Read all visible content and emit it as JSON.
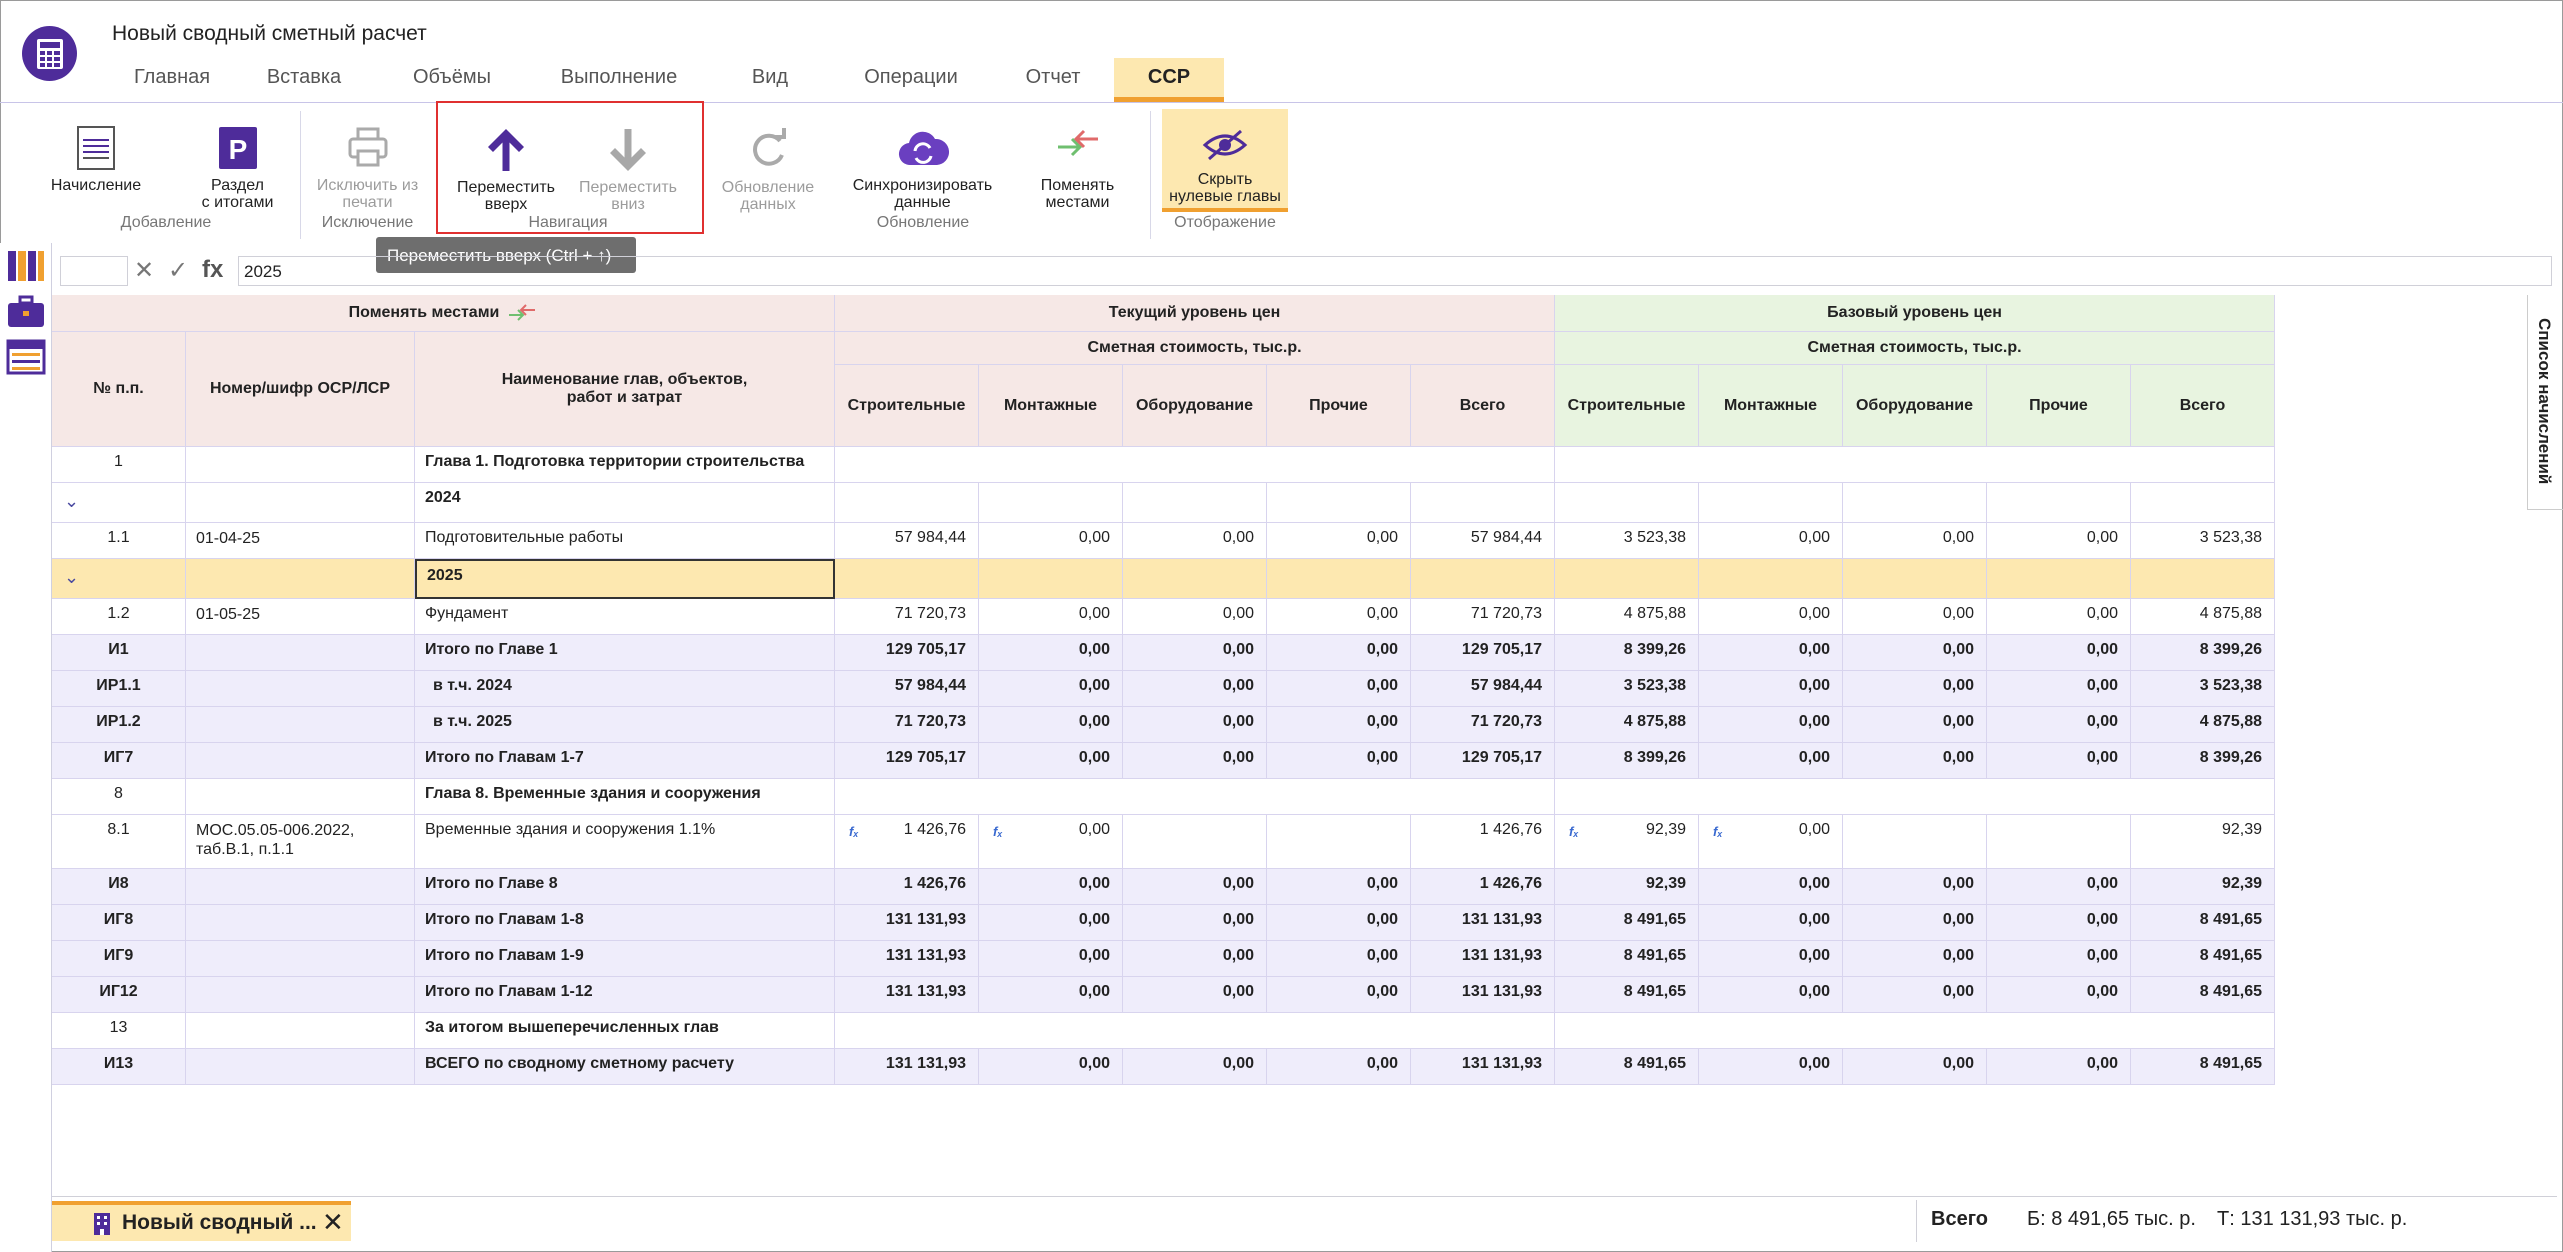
{
  "window": {
    "title": "Новый сводный сметный расчет"
  },
  "tabs": [
    {
      "label": "Главная"
    },
    {
      "label": "Вставка"
    },
    {
      "label": "Объёмы"
    },
    {
      "label": "Выполнение"
    },
    {
      "label": "Вид"
    },
    {
      "label": "Операции"
    },
    {
      "label": "Отчет"
    },
    {
      "label": "ССР",
      "active": true
    }
  ],
  "ribbon": {
    "buttons": {
      "accrual": "Начисление",
      "section_line1": "Раздел",
      "section_line2": "с итогами",
      "exclude_line1": "Исключить из",
      "exclude_line2": "печати",
      "up_line1": "Переместить",
      "up_line2": "вверх",
      "down_line1": "Переместить",
      "down_line2": "вниз",
      "refresh_line1": "Обновление",
      "refresh_line2": "данных",
      "sync_line1": "Синхронизировать",
      "sync_line2": "данные",
      "swap_line1": "Поменять",
      "swap_line2": "местами",
      "hide_line1": "Скрыть",
      "hide_line2": "нулевые главы"
    },
    "groups": {
      "add": "Добавление",
      "exclude": "Исключение",
      "nav": "Навигация",
      "update": "Обновление",
      "display": "Отображение"
    },
    "tooltip": "Переместить вверх (Ctrl + ↑)"
  },
  "formula_bar": {
    "value": "2025",
    "fx": "fx",
    "cancel": "✕",
    "accept": "✓"
  },
  "grid": {
    "header": {
      "swap": "Поменять местами",
      "current": "Текущий уровень цен",
      "base": "Базовый уровень цен",
      "cost_current": "Сметная стоимость, тыс.р.",
      "cost_base": "Сметная стоимость, тыс.р.",
      "col_no": "№ п.п.",
      "col_code": "Номер/шифр ОСР/ЛСР",
      "col_name_line1": "Наименование глав, объектов,",
      "col_name_line2": "работ и затрат",
      "sub": [
        "Строительные",
        "Монтажные",
        "Оборудование",
        "Прочие",
        "Всего"
      ]
    },
    "rows": [
      {
        "no": "1",
        "code": "",
        "name": "Глава 1. Подготовка территории строительства",
        "bold_name": true,
        "cur": [],
        "base": []
      },
      {
        "no": "",
        "code": "",
        "name": "2024",
        "bold_name": true,
        "chevron": true,
        "cur": [],
        "base": [],
        "grid_vals": true
      },
      {
        "no": "1.1",
        "code": "01-04-25",
        "name": "Подготовительные работы",
        "cur": [
          "57 984,44",
          "0,00",
          "0,00",
          "0,00",
          "57 984,44"
        ],
        "base": [
          "3 523,38",
          "0,00",
          "0,00",
          "0,00",
          "3 523,38"
        ]
      },
      {
        "no": "",
        "code": "",
        "name": "2025",
        "bold_name": true,
        "chevron": true,
        "selected": true,
        "cur": [],
        "base": [],
        "grid_vals": true
      },
      {
        "no": "1.2",
        "code": "01-05-25",
        "name": "Фундамент",
        "cur": [
          "71 720,73",
          "0,00",
          "0,00",
          "0,00",
          "71 720,73"
        ],
        "base": [
          "4 875,88",
          "0,00",
          "0,00",
          "0,00",
          "4 875,88"
        ]
      },
      {
        "no": "И1",
        "code": "",
        "name": "Итого по Главе 1",
        "total": true,
        "cur": [
          "129 705,17",
          "0,00",
          "0,00",
          "0,00",
          "129 705,17"
        ],
        "base": [
          "8 399,26",
          "0,00",
          "0,00",
          "0,00",
          "8 399,26"
        ]
      },
      {
        "no": "ИР1.1",
        "code": "",
        "name": "в т.ч. 2024",
        "total": true,
        "indent": true,
        "cur": [
          "57 984,44",
          "0,00",
          "0,00",
          "0,00",
          "57 984,44"
        ],
        "base": [
          "3 523,38",
          "0,00",
          "0,00",
          "0,00",
          "3 523,38"
        ]
      },
      {
        "no": "ИР1.2",
        "code": "",
        "name": "в т.ч. 2025",
        "total": true,
        "indent": true,
        "cur": [
          "71 720,73",
          "0,00",
          "0,00",
          "0,00",
          "71 720,73"
        ],
        "base": [
          "4 875,88",
          "0,00",
          "0,00",
          "0,00",
          "4 875,88"
        ]
      },
      {
        "no": "ИГ7",
        "code": "",
        "name": "Итого по Главам 1-7",
        "total": true,
        "cur": [
          "129 705,17",
          "0,00",
          "0,00",
          "0,00",
          "129 705,17"
        ],
        "base": [
          "8 399,26",
          "0,00",
          "0,00",
          "0,00",
          "8 399,26"
        ]
      },
      {
        "no": "8",
        "code": "",
        "name": "Глава 8. Временные здания и сооружения",
        "bold_name": true,
        "cur": [],
        "base": []
      },
      {
        "no": "8.1",
        "code": "МОС.05.05-006.2022,",
        "code2": "таб.В.1, п.1.1",
        "name": "Временные здания и сооружения 1.1%",
        "tall": true,
        "fx": true,
        "cur": [
          "1 426,76",
          "0,00",
          "",
          "",
          "1 426,76"
        ],
        "base": [
          "92,39",
          "0,00",
          "",
          "",
          "92,39"
        ]
      },
      {
        "no": "И8",
        "code": "",
        "name": "Итого по Главе 8",
        "total": true,
        "cur": [
          "1 426,76",
          "0,00",
          "0,00",
          "0,00",
          "1 426,76"
        ],
        "base": [
          "92,39",
          "0,00",
          "0,00",
          "0,00",
          "92,39"
        ]
      },
      {
        "no": "ИГ8",
        "code": "",
        "name": "Итого по Главам 1-8",
        "total": true,
        "cur": [
          "131 131,93",
          "0,00",
          "0,00",
          "0,00",
          "131 131,93"
        ],
        "base": [
          "8 491,65",
          "0,00",
          "0,00",
          "0,00",
          "8 491,65"
        ]
      },
      {
        "no": "ИГ9",
        "code": "",
        "name": "Итого по Главам 1-9",
        "total": true,
        "cur": [
          "131 131,93",
          "0,00",
          "0,00",
          "0,00",
          "131 131,93"
        ],
        "base": [
          "8 491,65",
          "0,00",
          "0,00",
          "0,00",
          "8 491,65"
        ]
      },
      {
        "no": "ИГ12",
        "code": "",
        "name": "Итого по Главам 1-12",
        "total": true,
        "cur": [
          "131 131,93",
          "0,00",
          "0,00",
          "0,00",
          "131 131,93"
        ],
        "base": [
          "8 491,65",
          "0,00",
          "0,00",
          "0,00",
          "8 491,65"
        ]
      },
      {
        "no": "13",
        "code": "",
        "name": "За итогом вышеперечисленных глав",
        "bold_name": true,
        "cur": [],
        "base": []
      },
      {
        "no": "И13",
        "code": "",
        "name": "ВСЕГО по сводному сметному расчету",
        "total": true,
        "cur": [
          "131 131,93",
          "0,00",
          "0,00",
          "0,00",
          "131 131,93"
        ],
        "base": [
          "8 491,65",
          "0,00",
          "0,00",
          "0,00",
          "8 491,65"
        ]
      }
    ],
    "fx_mark": "fₓ"
  },
  "side_panel": {
    "label": "Список начислений"
  },
  "bottom": {
    "doc_tab": "Новый сводный ...",
    "close": "✕",
    "total_label": "Всего",
    "total_base": "Б: 8 491,65 тыс. р.",
    "total_current": "Т: 131 131,93 тыс. р."
  },
  "colors": {
    "accent": "#4e2c9a",
    "tab_active_bg": "#fde8b0",
    "tab_active_border": "#f0a030",
    "header_current": "#f6e8e6",
    "header_base": "#e8f4e0",
    "total_row": "#efedfb",
    "selected_row": "#fde8b0",
    "highlight": "#e03030"
  }
}
